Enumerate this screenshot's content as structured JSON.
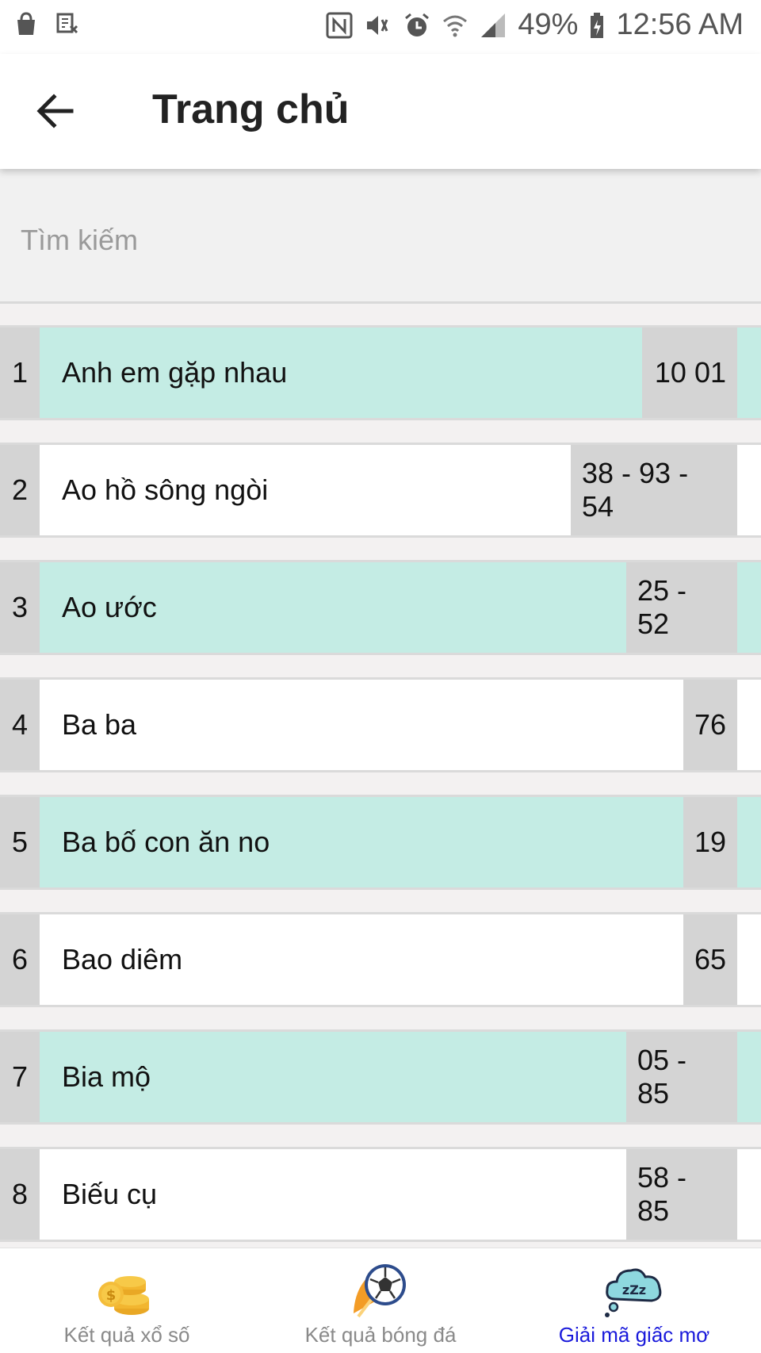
{
  "status_bar": {
    "battery": "49%",
    "time": "12:56 AM",
    "icons": [
      "shopping-bag-icon",
      "screenshot-icon",
      "nfc-icon",
      "vibrate-icon",
      "alarm-icon",
      "wifi-icon",
      "signal-icon",
      "battery-icon"
    ]
  },
  "app_bar": {
    "title": "Trang chủ",
    "back_icon": "arrow-left-icon"
  },
  "search": {
    "placeholder": "Tìm kiếm",
    "value": ""
  },
  "colors": {
    "highlight": "#c4ece4",
    "white": "#ffffff",
    "index_bg": "#d4d4d4",
    "active_tab": "#1a1adb"
  },
  "list": {
    "items": [
      {
        "index": "1",
        "name": "Anh em gặp nhau",
        "numbers": "10 01",
        "highlighted": true
      },
      {
        "index": "2",
        "name": "Ao hồ sông ngòi",
        "numbers": "38 - 93 - 54",
        "highlighted": false
      },
      {
        "index": "3",
        "name": "Ao ước",
        "numbers": "25 - 52",
        "highlighted": true
      },
      {
        "index": "4",
        "name": "Ba ba",
        "numbers": "76",
        "highlighted": false
      },
      {
        "index": "5",
        "name": "Ba bố con ăn no",
        "numbers": "19",
        "highlighted": true
      },
      {
        "index": "6",
        "name": "Bao diêm",
        "numbers": "65",
        "highlighted": false
      },
      {
        "index": "7",
        "name": "Bia mộ",
        "numbers": "05 - 85",
        "highlighted": true
      },
      {
        "index": "8",
        "name": "Biếu cụ",
        "numbers": "58 - 85",
        "highlighted": false
      }
    ]
  },
  "bottom_nav": {
    "tabs": [
      {
        "label": "Kết quả xổ số",
        "icon": "coins-icon",
        "active": false
      },
      {
        "label": "Kết quả bóng đá",
        "icon": "soccer-ball-icon",
        "active": false
      },
      {
        "label": "Giải mã giấc mơ",
        "icon": "sleep-cloud-icon",
        "active": true
      }
    ]
  }
}
